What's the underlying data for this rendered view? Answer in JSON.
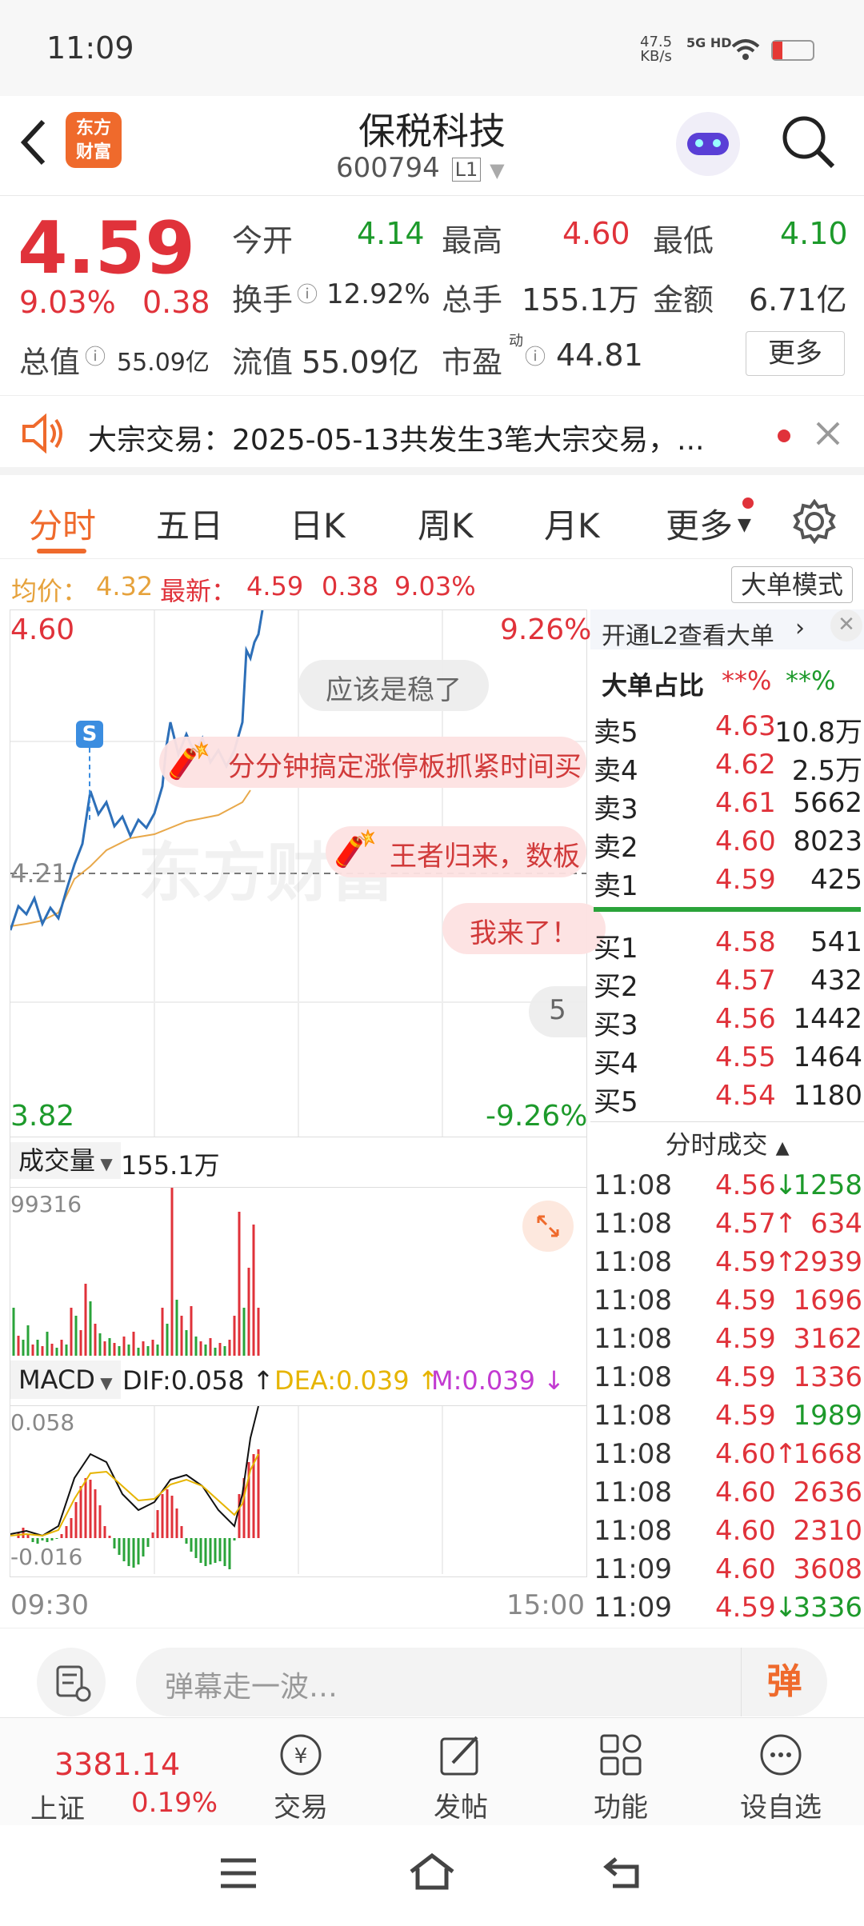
{
  "status_bar": {
    "time": "11:09",
    "net_speed": "47.5",
    "net_unit": "KB/s",
    "signal": "5G HD"
  },
  "header": {
    "title": "保税科技",
    "code": "600794",
    "level": "L1",
    "logo_text": "东方财富"
  },
  "quote": {
    "price": "4.59",
    "pct": "9.03%",
    "change": "0.38",
    "open_label": "今开",
    "open": "4.14",
    "high_label": "最高",
    "high": "4.60",
    "low_label": "最低",
    "low": "4.10",
    "turnover_label": "换手",
    "turnover": "12.92%",
    "volume_label": "总手",
    "volume": "155.1万",
    "amount_label": "金额",
    "amount": "6.71亿",
    "mktcap_label": "总值",
    "mktcap": "55.09亿",
    "float_label": "流值",
    "float": "55.09亿",
    "pe_label": "市盈",
    "pe_sup": "动",
    "pe": "44.81",
    "more": "更多"
  },
  "notice": {
    "text": "大宗交易：2025-05-13共发生3笔大宗交易，..."
  },
  "tabs": [
    "分时",
    "五日",
    "日K",
    "周K",
    "月K",
    "更多"
  ],
  "avg_bar": {
    "avg_label": "均价：",
    "avg": "4.32",
    "latest_label": "最新：",
    "latest": "4.59",
    "chg": "0.38",
    "pct": "9.03%",
    "mode_button": "大单模式"
  },
  "chart": {
    "y_top": "4.60",
    "y_top_pct": "9.26%",
    "y_mid": "4.21",
    "y_bottom": "3.82",
    "y_bottom_pct": "-9.26%",
    "s_marker": "S",
    "time_start": "09:30",
    "time_end": "15:00",
    "watermark": "东方财富"
  },
  "danmu": [
    "应该是稳了",
    "分分钟搞定涨停板抓紧时间买",
    "王者归来，数板",
    "我来了！",
    "5"
  ],
  "volume_panel": {
    "label": "成交量",
    "total": "155.1万",
    "max": "99316"
  },
  "macd_panel": {
    "label": "MACD",
    "dif": "DIF:0.058",
    "dea": "DEA:0.039",
    "m": "M:0.039",
    "top": "0.058",
    "bottom": "-0.016"
  },
  "orderbook": {
    "l2_link": "开通L2查看大单",
    "big_ratio_label": "大单占比",
    "big_red": "**%",
    "big_green": "**%",
    "asks": [
      {
        "label": "卖5",
        "price": "4.63",
        "vol": "10.8万"
      },
      {
        "label": "卖4",
        "price": "4.62",
        "vol": "2.5万"
      },
      {
        "label": "卖3",
        "price": "4.61",
        "vol": "5662"
      },
      {
        "label": "卖2",
        "price": "4.60",
        "vol": "8023"
      },
      {
        "label": "卖1",
        "price": "4.59",
        "vol": "425"
      }
    ],
    "bids": [
      {
        "label": "买1",
        "price": "4.58",
        "vol": "541"
      },
      {
        "label": "买2",
        "price": "4.57",
        "vol": "432"
      },
      {
        "label": "买3",
        "price": "4.56",
        "vol": "1442"
      },
      {
        "label": "买4",
        "price": "4.55",
        "vol": "1464"
      },
      {
        "label": "买5",
        "price": "4.54",
        "vol": "1180"
      }
    ],
    "trades_label": "分时成交",
    "trades": [
      {
        "t": "11:08",
        "p": "4.56",
        "a": "↓",
        "v": "1258",
        "c": "green"
      },
      {
        "t": "11:08",
        "p": "4.57",
        "a": "↑",
        "v": "634",
        "c": "red"
      },
      {
        "t": "11:08",
        "p": "4.59",
        "a": "↑",
        "v": "2939",
        "c": "red"
      },
      {
        "t": "11:08",
        "p": "4.59",
        "a": "",
        "v": "1696",
        "c": "red"
      },
      {
        "t": "11:08",
        "p": "4.59",
        "a": "",
        "v": "3162",
        "c": "red"
      },
      {
        "t": "11:08",
        "p": "4.59",
        "a": "",
        "v": "1336",
        "c": "red"
      },
      {
        "t": "11:08",
        "p": "4.59",
        "a": "",
        "v": "1989",
        "c": "green"
      },
      {
        "t": "11:08",
        "p": "4.60",
        "a": "↑",
        "v": "1668",
        "c": "red"
      },
      {
        "t": "11:08",
        "p": "4.60",
        "a": "",
        "v": "2636",
        "c": "red"
      },
      {
        "t": "11:08",
        "p": "4.60",
        "a": "",
        "v": "2310",
        "c": "red"
      },
      {
        "t": "11:09",
        "p": "4.60",
        "a": "",
        "v": "3608",
        "c": "red"
      },
      {
        "t": "11:09",
        "p": "4.59",
        "a": "↓",
        "v": "3336",
        "c": "green"
      }
    ]
  },
  "comment": {
    "placeholder": "弹幕走一波…",
    "send": "弹"
  },
  "bottom_nav": {
    "index_value": "3381.14",
    "index_name": "上证",
    "index_pct": "0.19%",
    "items": [
      "交易",
      "发帖",
      "功能",
      "设自选"
    ]
  }
}
